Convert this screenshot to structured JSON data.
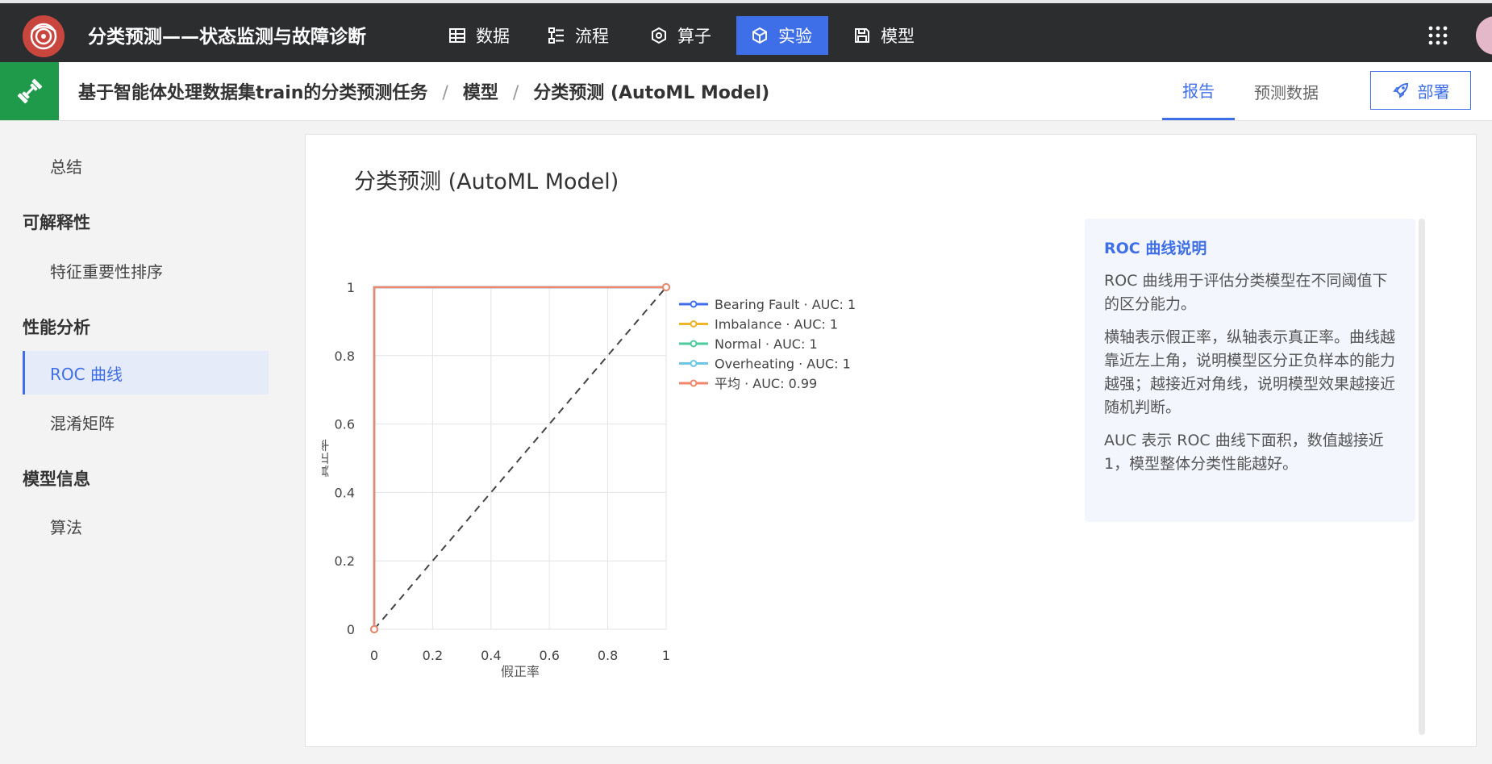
{
  "app": {
    "title": "分类预测——状态监测与故障诊断"
  },
  "nav": [
    {
      "label": "数据",
      "icon": "table-icon"
    },
    {
      "label": "流程",
      "icon": "flow-icon"
    },
    {
      "label": "算子",
      "icon": "hexagon-icon"
    },
    {
      "label": "实验",
      "icon": "cube-icon",
      "active": true
    },
    {
      "label": "模型",
      "icon": "save-icon"
    }
  ],
  "breadcrumb": {
    "task": "基于智能体处理数据集train的分类预测任务",
    "sep": "/",
    "model": "模型",
    "current": "分类预测 (AutoML Model)"
  },
  "tabs": {
    "report": "报告",
    "predict": "预测数据"
  },
  "deploy_label": "部署",
  "sidebar": {
    "summary": "总结",
    "explain_heading": "可解释性",
    "feature_rank": "特征重要性排序",
    "perf_heading": "性能分析",
    "roc": "ROC 曲线",
    "confusion": "混淆矩阵",
    "info_heading": "模型信息",
    "algorithm": "算法"
  },
  "report": {
    "title": "分类预测 (AutoML Model)"
  },
  "info": {
    "title": "ROC 曲线说明",
    "p1": "ROC 曲线用于评估分类模型在不同阈值下的区分能力。",
    "p2": "横轴表示假正率，纵轴表示真正率。曲线越靠近左上角，说明模型区分正负样本的能力越强；越接近对角线，说明模型效果越接近随机判断。",
    "p3": "AUC 表示 ROC 曲线下面积，数值越接近 1，模型整体分类性能越好。"
  },
  "chart_data": {
    "type": "line",
    "xlabel": "假正率",
    "ylabel": "真正率",
    "xlim": [
      0,
      1
    ],
    "ylim": [
      0,
      1
    ],
    "xticks": [
      "0",
      "0.2",
      "0.4",
      "0.6",
      "0.8",
      "1"
    ],
    "yticks": [
      "0",
      "0.2",
      "0.4",
      "0.6",
      "0.8",
      "1"
    ],
    "grid": true,
    "legend_position": "top-right",
    "series": [
      {
        "name": "Bearing Fault · AUC: 1",
        "color": "#3f6fe8",
        "x": [
          0,
          0,
          1
        ],
        "y": [
          0,
          1,
          1
        ]
      },
      {
        "name": "Imbalance · AUC: 1",
        "color": "#f0b429",
        "x": [
          0,
          0,
          1
        ],
        "y": [
          0,
          1,
          1
        ]
      },
      {
        "name": "Normal · AUC: 1",
        "color": "#4ecb9e",
        "x": [
          0,
          0,
          1
        ],
        "y": [
          0,
          1,
          1
        ]
      },
      {
        "name": "Overheating · AUC: 1",
        "color": "#6ec6e6",
        "x": [
          0,
          0,
          1
        ],
        "y": [
          0,
          1,
          1
        ]
      },
      {
        "name": "平均 · AUC: 0.99",
        "color": "#f0866a",
        "x": [
          0,
          0,
          1
        ],
        "y": [
          0,
          1,
          1
        ]
      }
    ],
    "reference_line": {
      "x": [
        0,
        1
      ],
      "y": [
        0,
        1
      ],
      "style": "dashed",
      "color": "#444444"
    }
  }
}
